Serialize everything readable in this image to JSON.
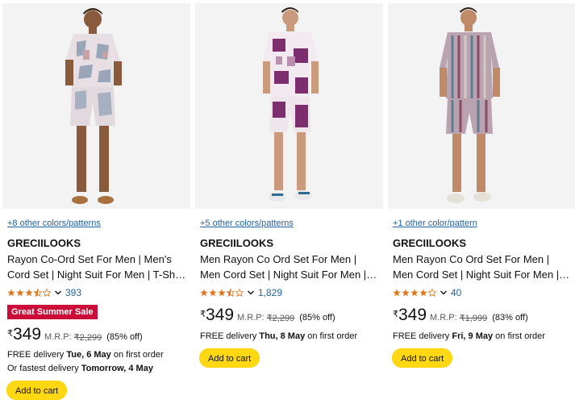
{
  "products": [
    {
      "image_alt": "man-in-printed-co-ord-set",
      "colors_link": "+8 other colors/patterns",
      "brand": "GRECIILOOKS",
      "title": "Rayon Co-Ord Set For Men | Men's Cord Set | Night Suit For Men | T-Shirt Shorts Set",
      "rating": 3.5,
      "rating_count": "393",
      "badge": "Great Summer Sale",
      "currency": "₹",
      "price": "349",
      "mrp_label": "M.R.P:",
      "mrp": "₹2,299",
      "discount": "(85% off)",
      "delivery_prefix": "FREE delivery",
      "delivery_date": "Tue, 6 May",
      "delivery_suffix": "on first order",
      "fast_prefix": "Or fastest delivery",
      "fast_date": "Tomorrow, 4 May",
      "cart_label": "Add to cart"
    },
    {
      "image_alt": "man-in-purple-printed-co-ord-set",
      "colors_link": "+5 other colors/patterns",
      "brand": "GRECIILOOKS",
      "title": "Men Rayon Co Ord Set For Men | Men Cord Set | Night Suit For Men | T-Shirt Shorts Set",
      "rating": 3.5,
      "rating_count": "1,829",
      "currency": "₹",
      "price": "349",
      "mrp_label": "M.R.P:",
      "mrp": "₹2,299",
      "discount": "(85% off)",
      "delivery_prefix": "FREE delivery",
      "delivery_date": "Thu, 8 May",
      "delivery_suffix": "on first order",
      "cart_label": "Add to cart"
    },
    {
      "image_alt": "man-in-striped-co-ord-set",
      "colors_link": "+1 other color/pattern",
      "brand": "GRECIILOOKS",
      "title": "Men Rayon Co Ord Set For Men | Men Cord Set | Night Suit For Men | T-Shirt Shorts Set",
      "rating": 4.0,
      "rating_count": "40",
      "currency": "₹",
      "price": "349",
      "mrp_label": "M.R.P:",
      "mrp": "₹1,999",
      "discount": "(83% off)",
      "delivery_prefix": "FREE delivery",
      "delivery_date": "Fri, 9 May",
      "delivery_suffix": "on first order",
      "cart_label": "Add to cart"
    }
  ],
  "colors": {
    "link": "#2162a1",
    "star": "#de7921",
    "badge": "#cc0c39",
    "cart_button": "#ffd814"
  }
}
